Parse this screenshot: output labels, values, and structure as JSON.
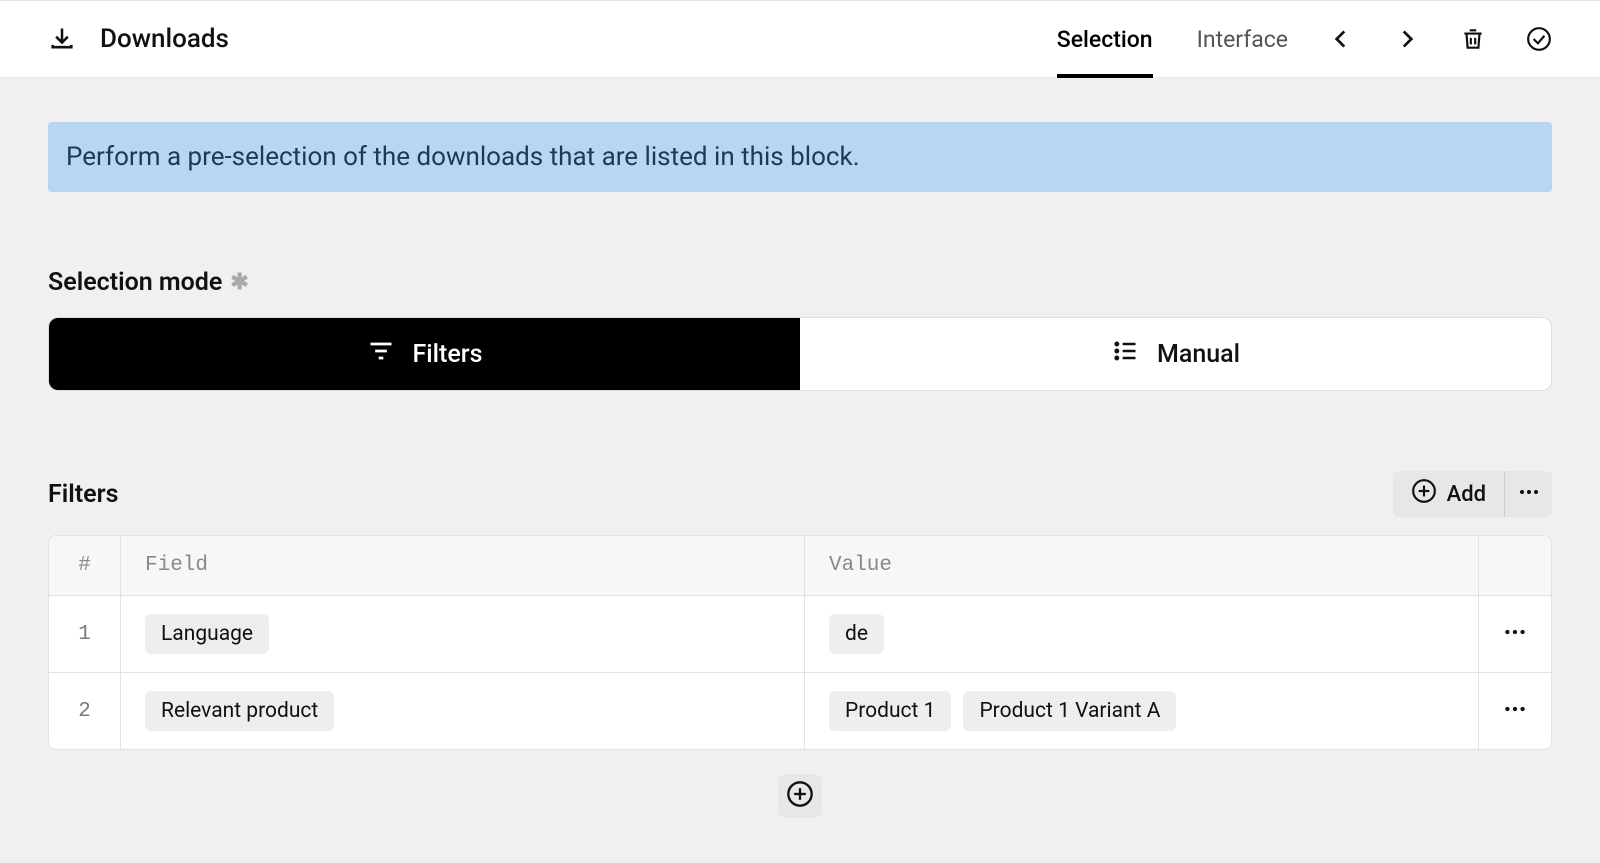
{
  "header": {
    "title": "Downloads",
    "tabs": [
      {
        "label": "Selection",
        "active": true
      },
      {
        "label": "Interface",
        "active": false
      }
    ]
  },
  "banner": {
    "text": "Perform a pre-selection of the downloads that are listed in this block."
  },
  "selection_mode": {
    "label": "Selection mode",
    "options": [
      {
        "label": "Filters",
        "active": true
      },
      {
        "label": "Manual",
        "active": false
      }
    ]
  },
  "filters": {
    "title": "Filters",
    "add_label": "Add",
    "columns": {
      "num": "#",
      "field": "Field",
      "value": "Value"
    },
    "rows": [
      {
        "num": "1",
        "field": "Language",
        "values": [
          "de"
        ]
      },
      {
        "num": "2",
        "field": "Relevant product",
        "values": [
          "Product 1",
          "Product 1 Variant A"
        ]
      }
    ]
  }
}
